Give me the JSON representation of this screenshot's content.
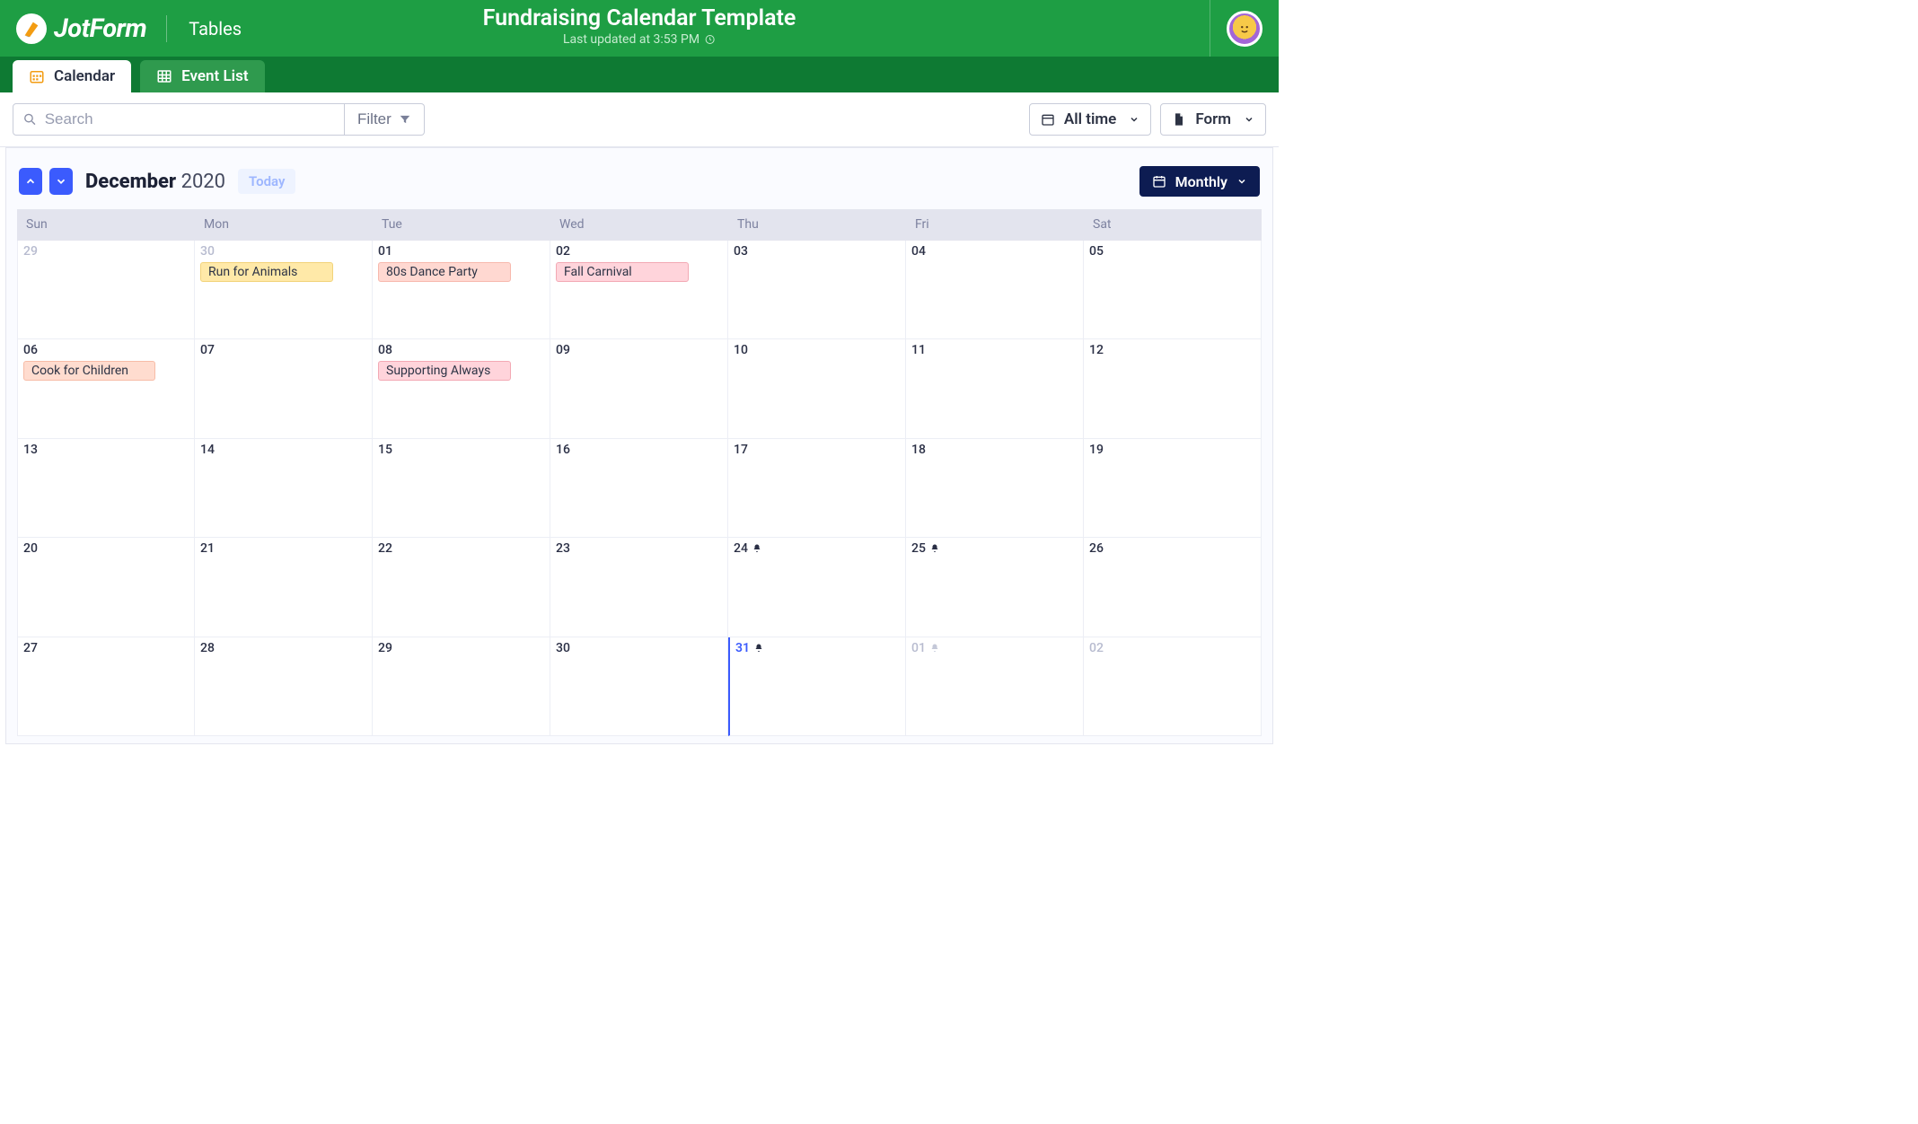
{
  "brand": {
    "name": "JotForm",
    "section": "Tables"
  },
  "header": {
    "title": "Fundraising Calendar Template",
    "subtitle": "Last updated at 3:53 PM"
  },
  "tabs": [
    {
      "label": "Calendar",
      "active": true
    },
    {
      "label": "Event List",
      "active": false
    }
  ],
  "toolbar": {
    "search_placeholder": "Search",
    "filter_label": "Filter",
    "range_label": "All time",
    "form_label": "Form"
  },
  "calendar": {
    "month": "December",
    "year": "2020",
    "today_label": "Today",
    "view_label": "Monthly",
    "weekdays": [
      "Sun",
      "Mon",
      "Tue",
      "Wed",
      "Thu",
      "Fri",
      "Sat"
    ],
    "weeks": [
      [
        {
          "num": "29",
          "out": true
        },
        {
          "num": "30",
          "out": true,
          "events": [
            {
              "label": "Run for Animals",
              "color": "yellow"
            }
          ]
        },
        {
          "num": "01",
          "events": [
            {
              "label": "80s Dance Party",
              "color": "salmon"
            }
          ]
        },
        {
          "num": "02",
          "events": [
            {
              "label": "Fall Carnival",
              "color": "pink"
            }
          ]
        },
        {
          "num": "03"
        },
        {
          "num": "04"
        },
        {
          "num": "05"
        }
      ],
      [
        {
          "num": "06",
          "events": [
            {
              "label": "Cook for Children",
              "color": "peach"
            }
          ]
        },
        {
          "num": "07"
        },
        {
          "num": "08",
          "events": [
            {
              "label": "Supporting Always",
              "color": "pink"
            }
          ]
        },
        {
          "num": "09"
        },
        {
          "num": "10"
        },
        {
          "num": "11"
        },
        {
          "num": "12"
        }
      ],
      [
        {
          "num": "13"
        },
        {
          "num": "14"
        },
        {
          "num": "15"
        },
        {
          "num": "16"
        },
        {
          "num": "17"
        },
        {
          "num": "18"
        },
        {
          "num": "19"
        }
      ],
      [
        {
          "num": "20"
        },
        {
          "num": "21"
        },
        {
          "num": "22"
        },
        {
          "num": "23"
        },
        {
          "num": "24",
          "bell": true
        },
        {
          "num": "25",
          "bell": true
        },
        {
          "num": "26"
        }
      ],
      [
        {
          "num": "27"
        },
        {
          "num": "28"
        },
        {
          "num": "29"
        },
        {
          "num": "30"
        },
        {
          "num": "31",
          "today": true,
          "bell": true
        },
        {
          "num": "01",
          "out": true,
          "bell": true,
          "bell_muted": true
        },
        {
          "num": "02",
          "out": true
        }
      ]
    ]
  }
}
